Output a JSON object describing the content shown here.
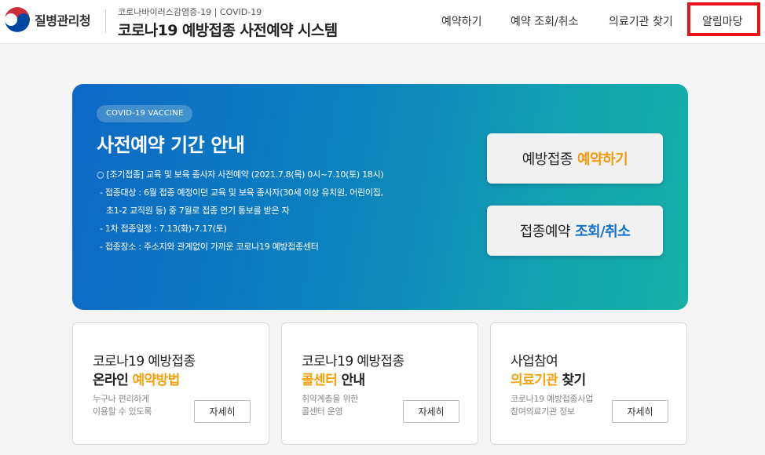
{
  "header": {
    "org_name": "질병관리청",
    "sub_title": "코로나바이러스감염증-19 | COVID-19",
    "main_title": "코로나19 예방접종 사전예약 시스템",
    "nav": [
      {
        "label": "예약하기"
      },
      {
        "label": "예약 조회/취소"
      },
      {
        "label": "의료기관 찾기"
      },
      {
        "label": "알림마당"
      }
    ],
    "highlight_color": "#e8131b"
  },
  "banner": {
    "badge": "COVID-19 VACCINE",
    "title": "사전예약 기간 안내",
    "lines": [
      "○ [조기접종] 교육 및 보육 종사자 사전예약 (2021.7.8(목) 0시~7.10(토) 18시)",
      "- 접종대상 : 6월 접종 예정이던 교육 및 보육 종사자(30세 이상 유치원, 어린이집,",
      "초1-2 교직원 등) 중 7월로 접종 연기 통보를 받은 자",
      "- 1차 접종일정 : 7.13(화)-7.17(토)",
      "- 접종장소 : 주소지와 관계없이 가까운 코로나19 예방접종센터"
    ],
    "cta_reserve": {
      "prefix": "예방접종",
      "highlight": "예약하기"
    },
    "cta_lookup": {
      "prefix": "접종예약",
      "highlight": "조회/취소"
    },
    "gradient_start": "#0d68c4",
    "gradient_end": "#16b1a6"
  },
  "cards": [
    {
      "line1": "코로나19 예방접종",
      "line2_plain": "온라인 ",
      "line2_accent": "예약방법",
      "line2_tail": "",
      "desc": [
        "누구나 편리하게",
        "이용할 수 있도록"
      ],
      "button": "자세히"
    },
    {
      "line1": "코로나19 예방접종",
      "line2_plain": "",
      "line2_accent": "콜센터",
      "line2_tail": " 안내",
      "desc": [
        "취약계층을 위한",
        "콜센터 운영"
      ],
      "button": "자세히"
    },
    {
      "line1": "사업참여",
      "line2_plain": "",
      "line2_accent": "의료기관",
      "line2_tail": " 찾기",
      "desc": [
        "코로나19 예방접종사업",
        "참여의료기관 정보"
      ],
      "button": "자세히"
    }
  ],
  "colors": {
    "accent_orange": "#f5a00d",
    "accent_blue": "#1170c7"
  }
}
